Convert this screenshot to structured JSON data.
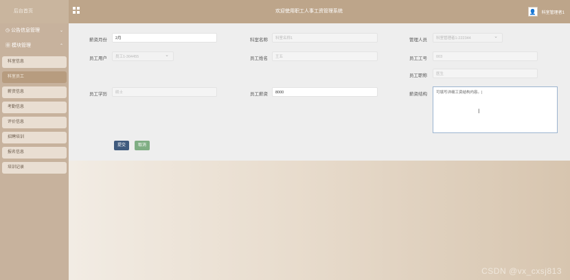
{
  "topbar": {
    "home": "后台首页",
    "title": "欢迎使用职工人事工资管理系统",
    "user": "科室管理者1"
  },
  "sidebar": {
    "announce": "公告信息管理",
    "module": "模块管理",
    "items": [
      {
        "label": "科室信息"
      },
      {
        "label": "科室员工"
      },
      {
        "label": "薪资信息"
      },
      {
        "label": "考勤信息"
      },
      {
        "label": "评价信息"
      },
      {
        "label": "招聘培训"
      },
      {
        "label": "报名信息"
      },
      {
        "label": "培训记录"
      }
    ]
  },
  "form": {
    "pay_month": {
      "label": "薪资月份",
      "value": "2月"
    },
    "dept_name": {
      "label": "科室名称",
      "placeholder": "科室名称1"
    },
    "manager": {
      "label": "管理人员",
      "value": "科室管理者1-222344"
    },
    "emp_user": {
      "label": "员工用户",
      "value": "员工1-304455"
    },
    "emp_name": {
      "label": "员工姓名",
      "placeholder": "王五"
    },
    "emp_no": {
      "label": "员工工号",
      "placeholder": "003"
    },
    "emp_title": {
      "label": "员工职称",
      "placeholder": "医生"
    },
    "emp_edu": {
      "label": "员工学历",
      "placeholder": "硕士"
    },
    "emp_salary": {
      "label": "员工薪资",
      "value": "8000"
    },
    "structure": {
      "label": "薪资结构",
      "value": "可填写详细工资结构内容。|"
    },
    "submit": "提交",
    "cancel": "取消"
  },
  "watermark": "CSDN @vx_cxsj813"
}
